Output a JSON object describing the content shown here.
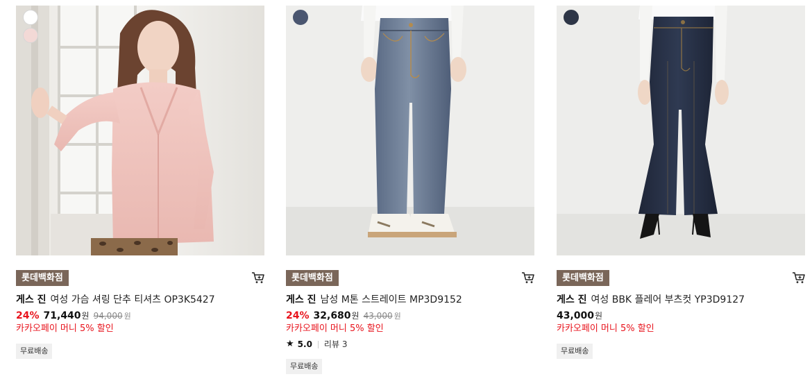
{
  "products": [
    {
      "store_badge": "롯데백화점",
      "brand": "게스 진",
      "name": "여성 가슴 셔링 단추 티셔츠 OP3K5427",
      "discount": "24%",
      "price": "71,440",
      "price_unit": "원",
      "original_price": "94,000",
      "original_unit": "원",
      "promo": "카카오페이 머니 5% 할인",
      "shipping": "무료배송",
      "swatch_colors": [
        "#ffffff",
        "#f3d9d6"
      ],
      "cart_icon": "cart-icon"
    },
    {
      "store_badge": "롯데백화점",
      "brand": "게스 진",
      "name": "남성 M톤 스트레이트 MP3D9152",
      "discount": "24%",
      "price": "32,680",
      "price_unit": "원",
      "original_price": "43,000",
      "original_unit": "원",
      "promo": "카카오페이 머니 5% 할인",
      "rating": "5.0",
      "reviews": "리뷰 3",
      "shipping": "무료배송",
      "swatch_colors": [
        "#4a5670"
      ],
      "cart_icon": "cart-icon"
    },
    {
      "store_badge": "롯데백화점",
      "brand": "게스 진",
      "name": "여성 BBK 플레어 부츠컷 YP3D9127",
      "price": "43,000",
      "price_unit": "원",
      "promo": "카카오페이 머니 5% 할인",
      "shipping": "무료배송",
      "swatch_colors": [
        "#2e3647"
      ],
      "cart_icon": "cart-icon"
    }
  ],
  "colors": {
    "badge_bg": "#7a6659",
    "discount_red": "#e8131c"
  }
}
